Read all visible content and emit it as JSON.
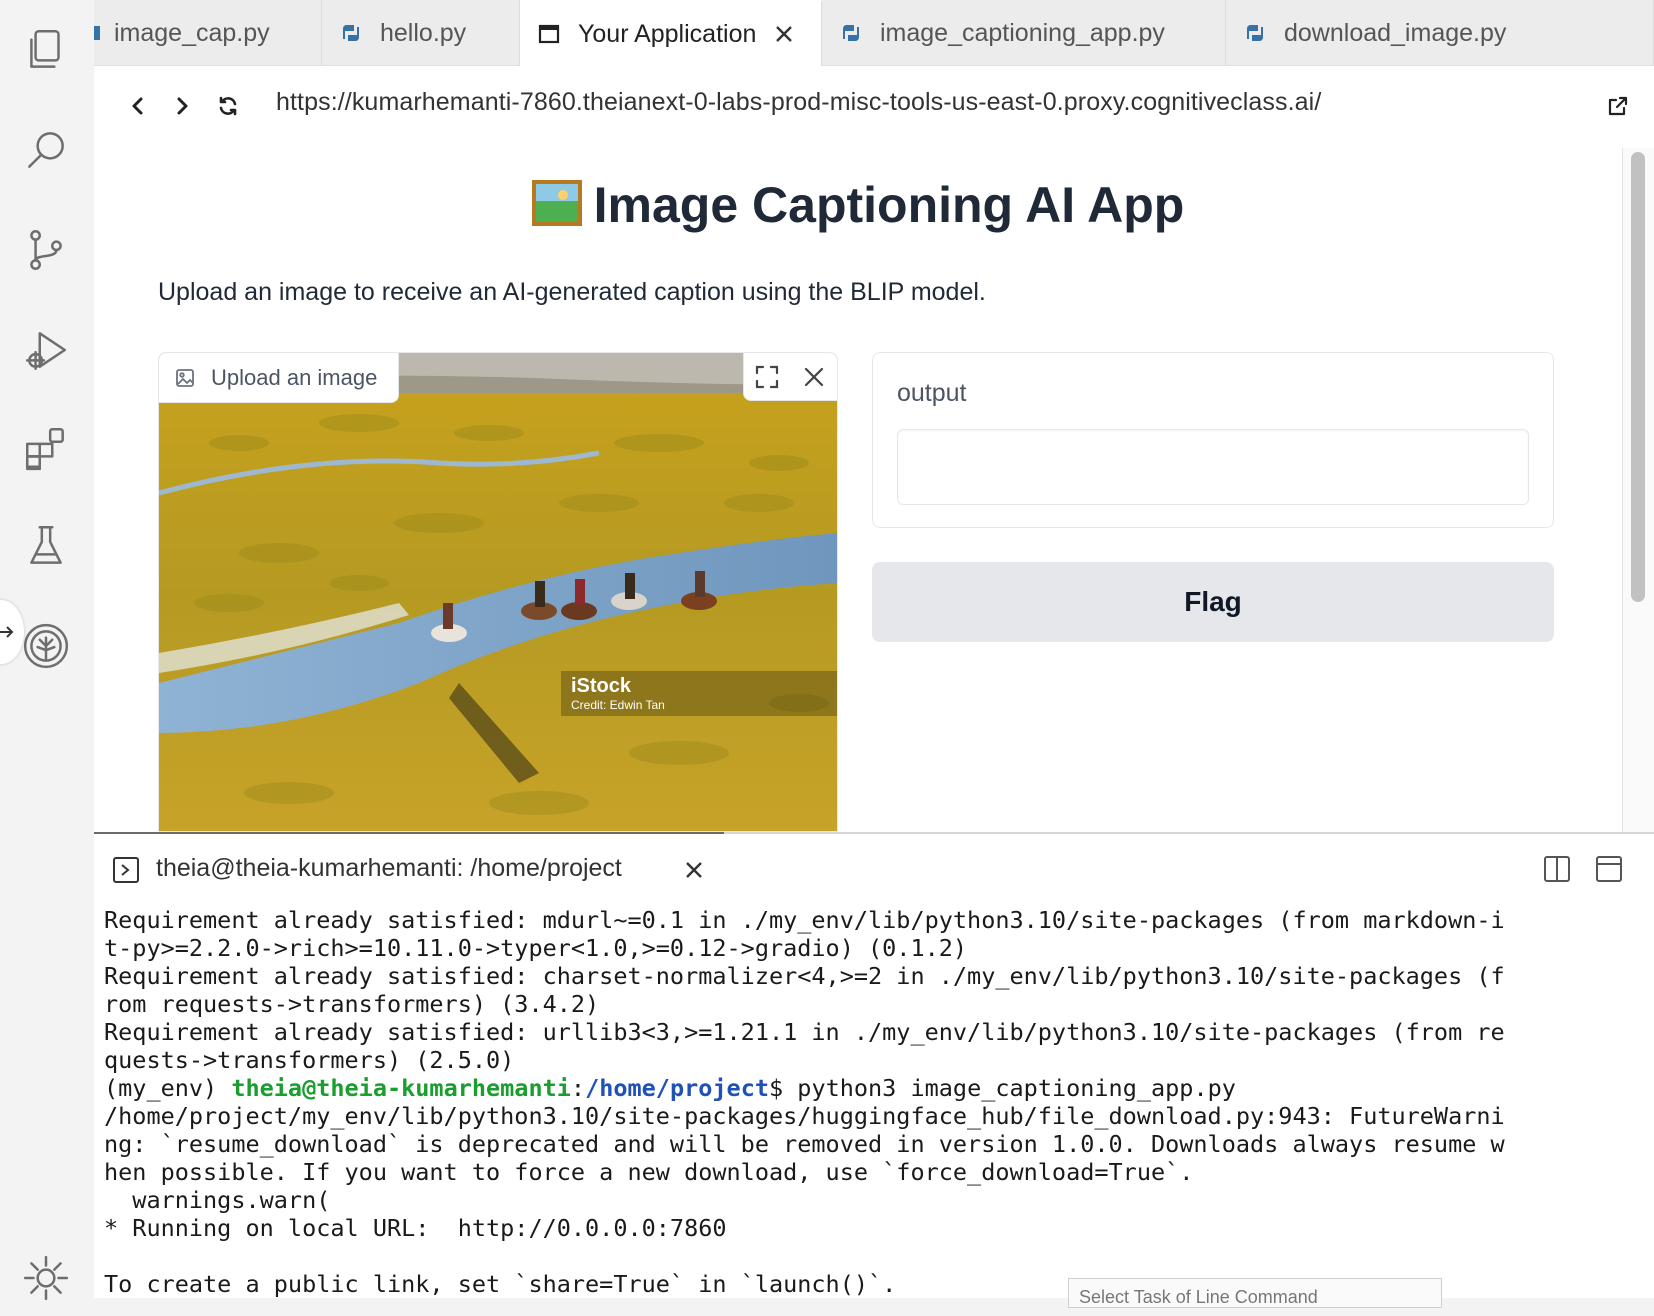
{
  "activity_bar": {
    "icons": [
      "files-icon",
      "search-icon",
      "source-control-icon",
      "run-debug-icon",
      "extensions-icon",
      "flask-icon",
      "tree-icon",
      "settings-gear-icon"
    ]
  },
  "tabs": [
    {
      "label": "image_cap.py",
      "icon": "python-icon",
      "active": false
    },
    {
      "label": "hello.py",
      "icon": "python-icon",
      "active": false
    },
    {
      "label": "Your Application",
      "icon": "window-icon",
      "active": true
    },
    {
      "label": "image_captioning_app.py",
      "icon": "python-icon",
      "active": false
    },
    {
      "label": "download_image.py",
      "icon": "python-icon",
      "active": false
    }
  ],
  "browser": {
    "url": "https://kumarhemanti-7860.theianext-0-labs-prod-misc-tools-us-east-0.proxy.cognitiveclass.ai/"
  },
  "app": {
    "title": "Image Captioning AI App",
    "description": "Upload an image to receive an AI-generated caption using the BLIP model.",
    "upload_label": "Upload an image",
    "watermark_brand": "iStock",
    "watermark_credit": "Credit: Edwin Tan",
    "output_label": "output",
    "output_value": "",
    "flag_label": "Flag"
  },
  "terminal": {
    "title": "theia@theia-kumarhemanti: /home/project",
    "lines": [
      "Requirement already satisfied: mdurl~=0.1 in ./my_env/lib/python3.10/site-packages (from markdown-i",
      "t-py>=2.2.0->rich>=10.11.0->typer<1.0,>=0.12->gradio) (0.1.2)",
      "Requirement already satisfied: charset-normalizer<4,>=2 in ./my_env/lib/python3.10/site-packages (f",
      "rom requests->transformers) (3.4.2)",
      "Requirement already satisfied: urllib3<3,>=1.21.1 in ./my_env/lib/python3.10/site-packages (from re",
      "quests->transformers) (2.5.0)"
    ],
    "prompt_env": "(my_env) ",
    "prompt_user": "theia@theia-kumarhemanti",
    "prompt_sep": ":",
    "prompt_path": "/home/project",
    "prompt_cmd": "$ python3 image_captioning_app.py",
    "lines_after": [
      "/home/project/my_env/lib/python3.10/site-packages/huggingface_hub/file_download.py:943: FutureWarni",
      "ng: `resume_download` is deprecated and will be removed in version 1.0.0. Downloads always resume w",
      "hen possible. If you want to force a new download, use `force_download=True`.",
      "  warnings.warn(",
      "* Running on local URL:  http://0.0.0.0:7860",
      "",
      "To create a public link, set `share=True` in `launch()`."
    ],
    "popup_text": "Select Task of Line Command"
  }
}
